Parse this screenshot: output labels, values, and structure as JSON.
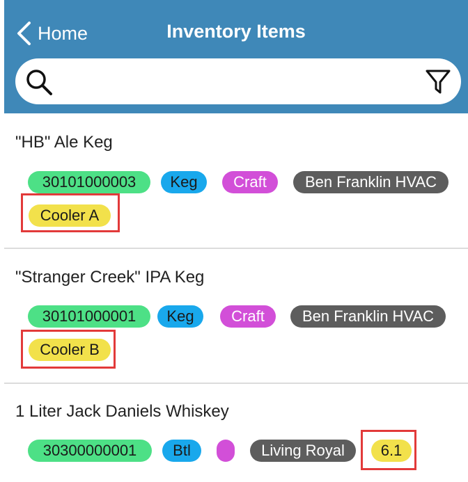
{
  "header": {
    "back_label": "Home",
    "title": "Inventory Items",
    "search_placeholder": ""
  },
  "items": [
    {
      "name": "\"HB\" Ale Keg",
      "code": "30101000003",
      "unit": "Keg",
      "category": "Craft",
      "vendor": "Ben Franklin HVAC",
      "location": "Cooler A"
    },
    {
      "name": "\"Stranger Creek\" IPA Keg",
      "code": "30101000001",
      "unit": "Keg",
      "category": "Craft",
      "vendor": "Ben Franklin HVAC",
      "location": "Cooler B"
    },
    {
      "name": "1 Liter Jack Daniels Whiskey",
      "code": "30300000001",
      "unit": "Btl",
      "category": "",
      "vendor": "Living Royal",
      "quantity": "6.1"
    }
  ],
  "colors": {
    "header_bg": "#3f88b8",
    "code_tag": "#4de086",
    "unit_tag": "#19a8ec",
    "category_tag": "#d24fd8",
    "vendor_tag": "#5d5d5d",
    "location_tag": "#f2e14b",
    "highlight_box": "#e23a3a"
  }
}
